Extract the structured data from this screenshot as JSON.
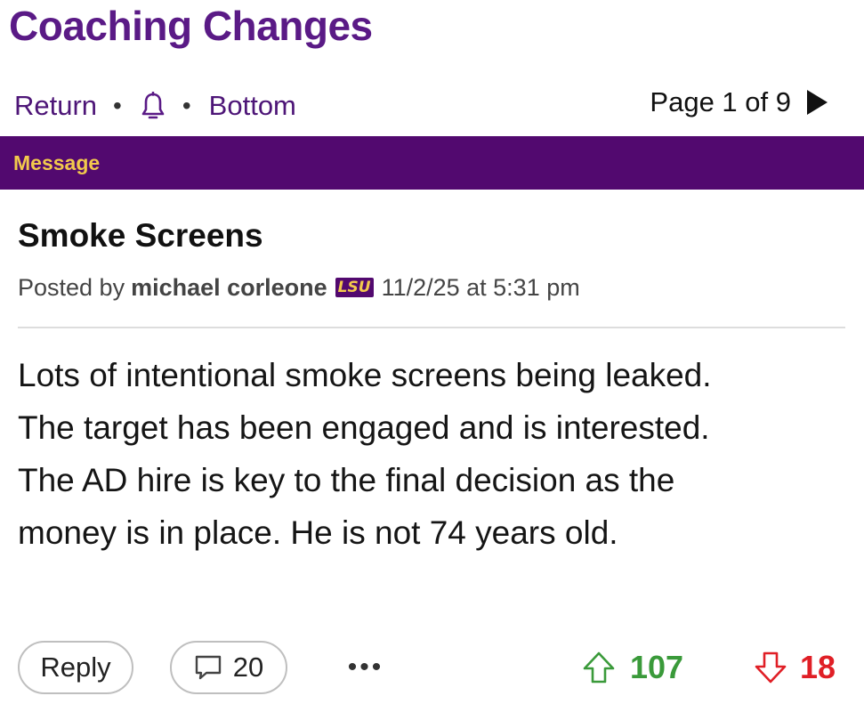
{
  "forum": {
    "title": "Coaching Changes"
  },
  "nav": {
    "return_label": "Return",
    "separator": "•",
    "bell_icon": "bell-icon",
    "bottom_label": "Bottom",
    "page_text": "Page 1 of 9",
    "next_icon": "play-arrow-icon"
  },
  "message_bar": {
    "label": "Message"
  },
  "post": {
    "subject": "Smoke Screens",
    "posted_by_label": "Posted by",
    "author": "michael corleone",
    "team_badge": "LSU",
    "timestamp": "11/2/25 at 5:31 pm",
    "body": [
      "Lots of intentional smoke screens being leaked.",
      "The target has been engaged and is interested.",
      "The AD hire is key to the final decision as the",
      "money is in place. He is not 74 years old."
    ]
  },
  "actions": {
    "reply_label": "Reply",
    "comment_icon": "comment-icon",
    "comment_count": "20",
    "more_label": "•••",
    "upvote_icon": "up-arrow-icon",
    "upvotes": "107",
    "downvote_icon": "down-arrow-icon",
    "downvotes": "18"
  },
  "colors": {
    "brand_purple": "#52096f",
    "title_purple": "#5a1a86",
    "gold": "#f2c94c",
    "upvote_green": "#3a9a3a",
    "downvote_red": "#e01f26"
  }
}
